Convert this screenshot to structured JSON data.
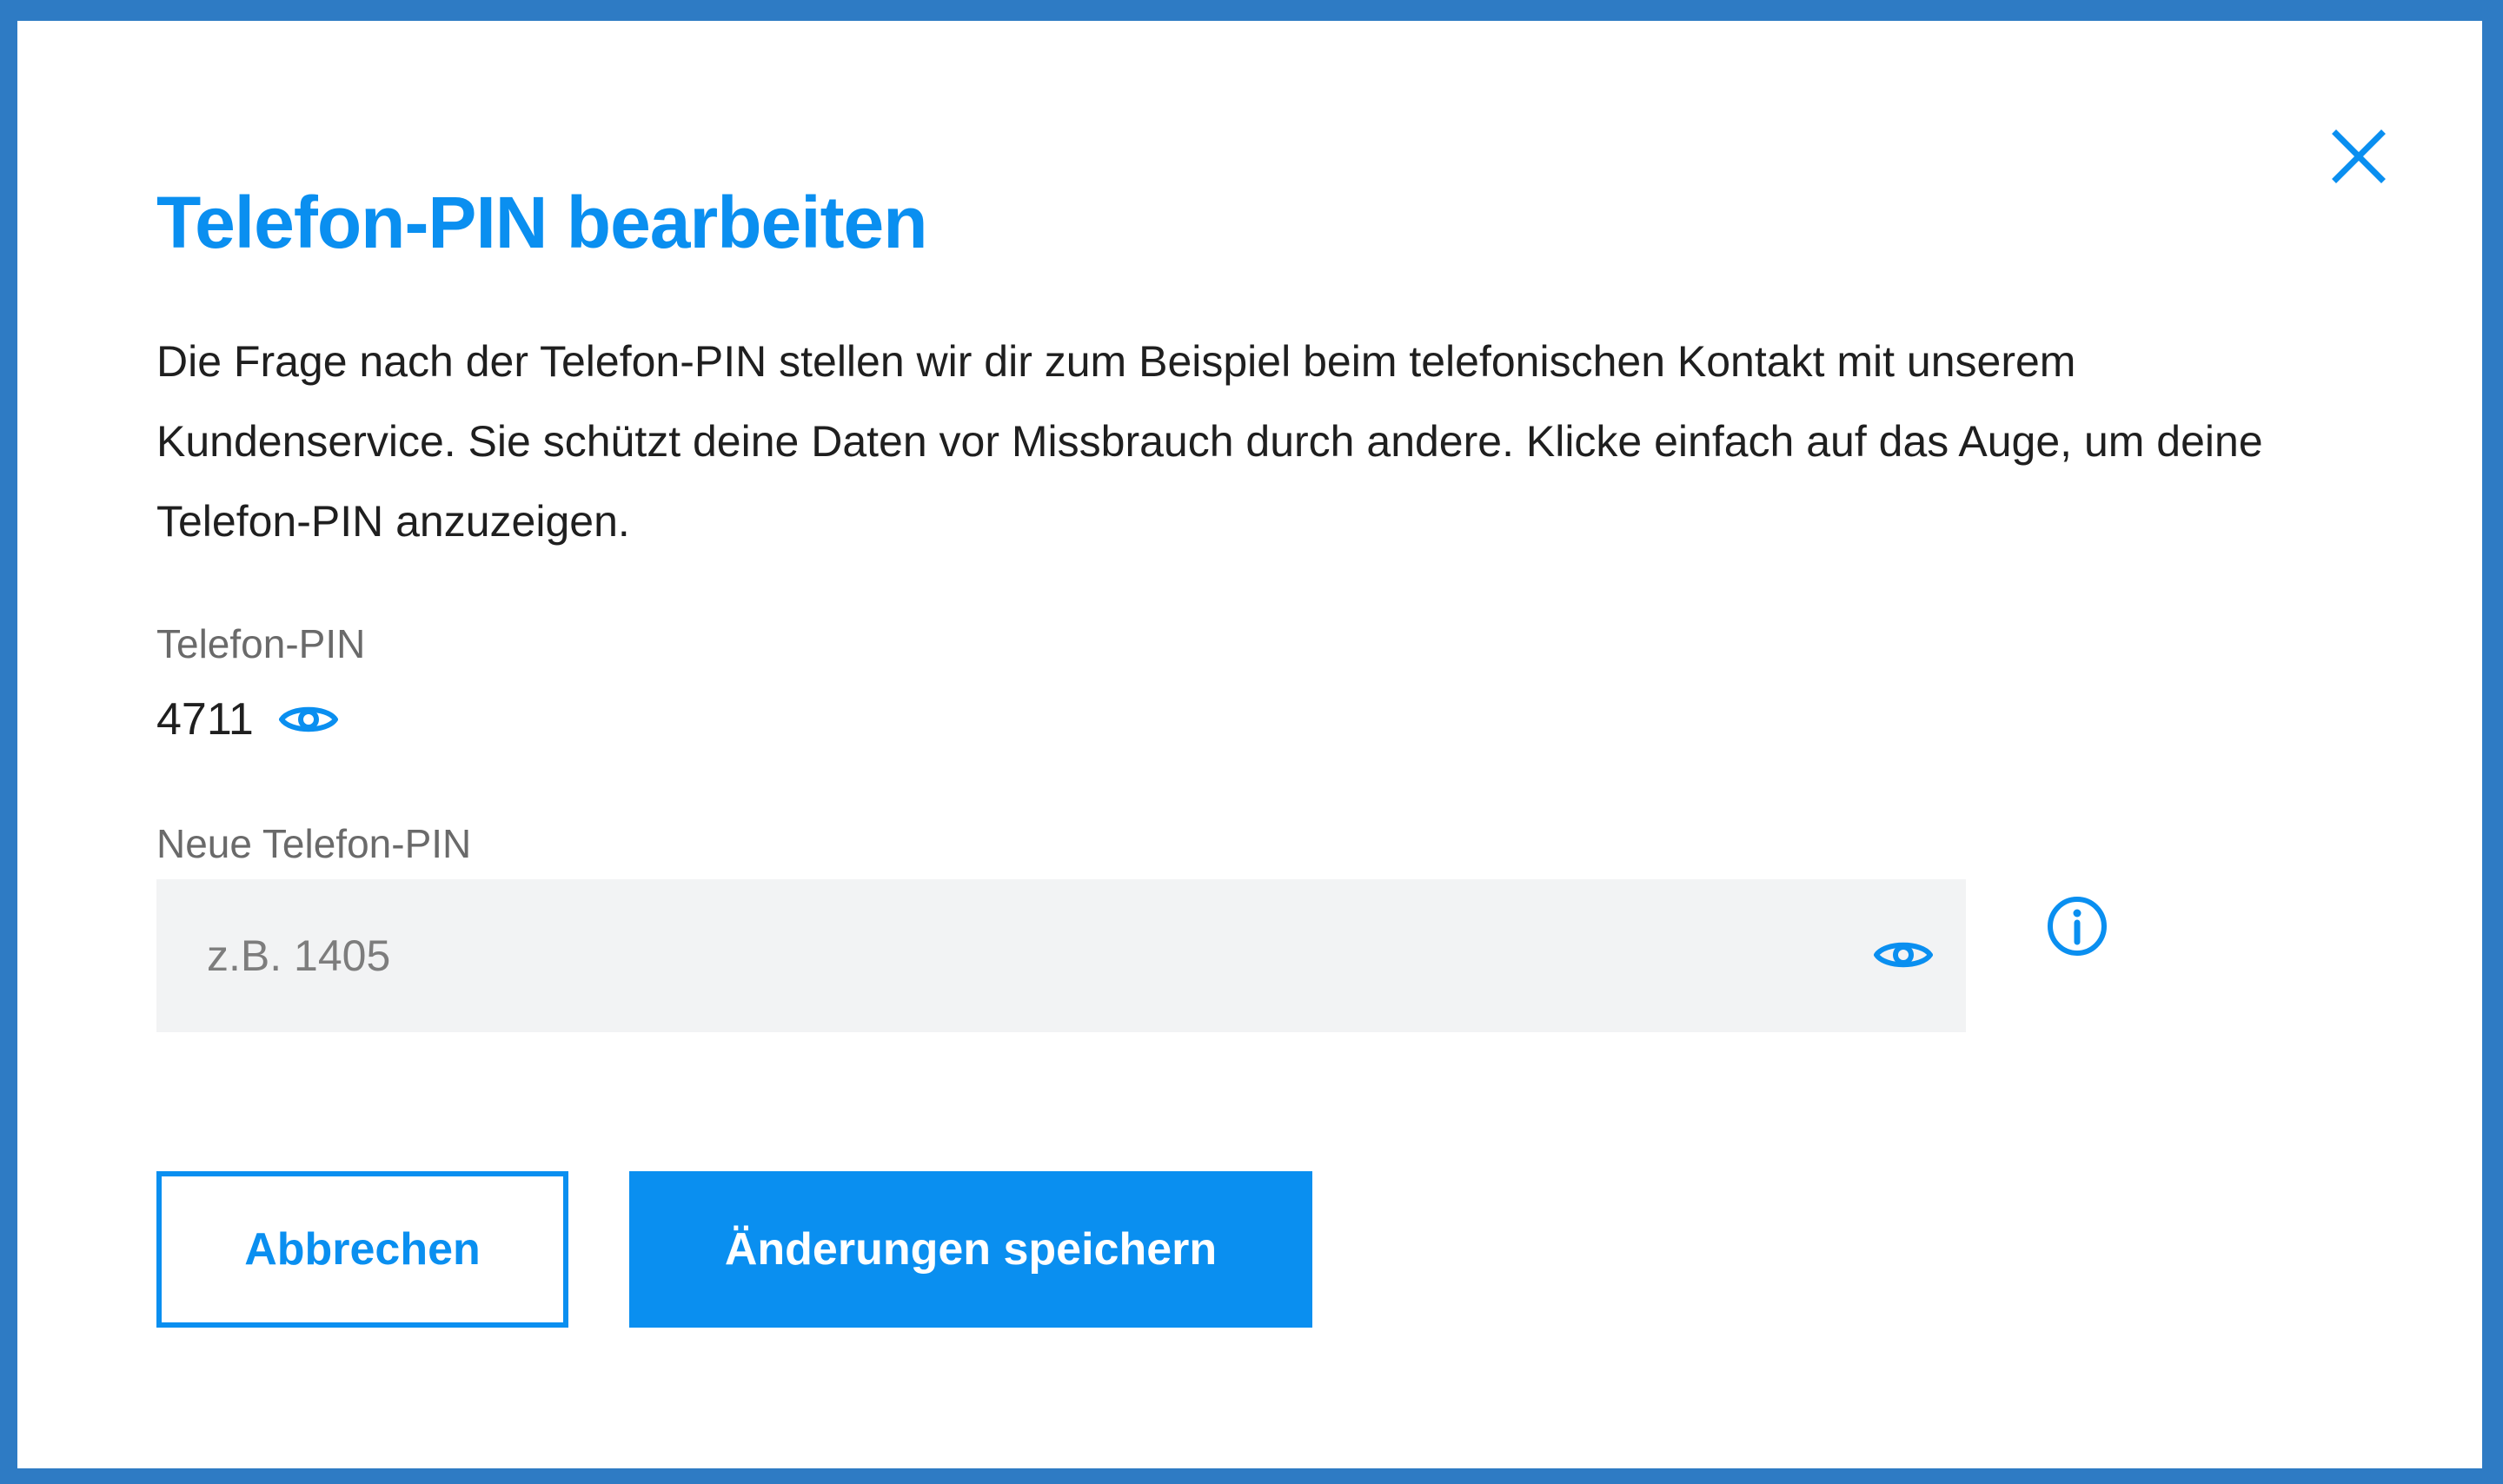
{
  "dialog": {
    "title": "Telefon-PIN bearbeiten",
    "description": "Die Frage nach der Telefon-PIN stellen wir dir zum Beispiel beim telefonischen Kontakt mit unserem Kundenservice. Sie schützt deine Daten vor Missbrauch durch andere. Klicke einfach auf das Auge, um deine Telefon-PIN anzuzeigen.",
    "close_icon": "close-icon"
  },
  "current_pin": {
    "label": "Telefon-PIN",
    "value": "4711",
    "toggle_icon": "eye-icon"
  },
  "new_pin": {
    "label": "Neue Telefon-PIN",
    "value": "",
    "placeholder": "z.B. 1405",
    "toggle_icon": "eye-icon",
    "info_icon": "info-icon"
  },
  "actions": {
    "cancel_label": "Abbrechen",
    "save_label": "Änderungen speichern"
  },
  "colors": {
    "accent": "#0a8ff0",
    "backdrop": "#2e7bc4",
    "input_background": "#f2f3f4",
    "text": "#1f1f1f",
    "label": "#6a6a6a"
  }
}
